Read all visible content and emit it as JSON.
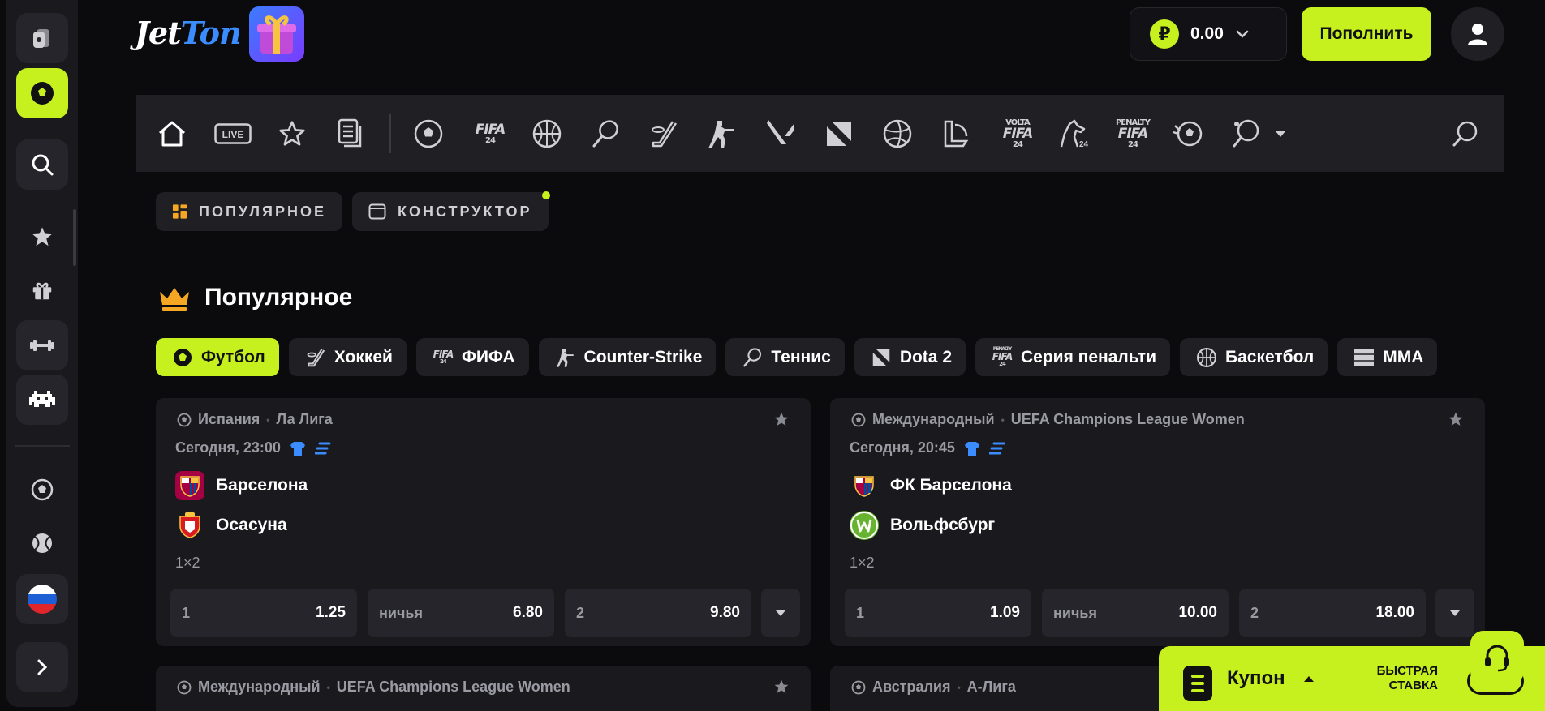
{
  "header": {
    "logo_part1": "Jet",
    "logo_part2": "Ton",
    "balance": "0.00",
    "currency_symbol": "₽",
    "deposit_label": "Пополнить"
  },
  "sports_nav": {
    "items": [
      "home-icon",
      "live-icon",
      "favorites-icon",
      "betslip-history-icon",
      "football-icon",
      "fifa-icon",
      "basketball-icon",
      "tennis-icon",
      "hockey-icon",
      "counter-strike-icon",
      "valorant-icon",
      "dota-icon",
      "volleyball-icon",
      "league-of-legends-icon",
      "volta-fifa-icon",
      "horse-racing-icon",
      "penalty-fifa-icon",
      "futsal-icon",
      "table-tennis-icon"
    ],
    "live_label": "LIVE",
    "fifa_label": "FIFA",
    "fifa_year": "24",
    "volta_label": "VOLTA",
    "penalty_label": "PENALTY"
  },
  "subtabs": {
    "popular": "ПОПУЛЯРНОЕ",
    "builder": "КОНСТРУКТОР"
  },
  "section": {
    "title": "Популярное"
  },
  "chips": [
    {
      "label": "Футбол",
      "icon": "football-icon",
      "active": true
    },
    {
      "label": "Хоккей",
      "icon": "hockey-icon"
    },
    {
      "label": "ФИФА",
      "icon": "fifa-icon"
    },
    {
      "label": "Counter-Strike",
      "icon": "counter-strike-icon"
    },
    {
      "label": "Теннис",
      "icon": "tennis-icon"
    },
    {
      "label": "Dota 2",
      "icon": "dota-icon"
    },
    {
      "label": "Серия пенальти",
      "icon": "penalty-fifa-icon"
    },
    {
      "label": "Баскетбол",
      "icon": "basketball-icon"
    },
    {
      "label": "MMA",
      "icon": "mma-icon"
    }
  ],
  "matches": [
    {
      "country": "Испания",
      "league": "Ла Лига",
      "time": "Сегодня, 23:00",
      "team1": "Барселона",
      "team2": "Осасуна",
      "market": "1×2",
      "odds": [
        {
          "label": "1",
          "value": "1.25"
        },
        {
          "label": "ничья",
          "value": "6.80"
        },
        {
          "label": "2",
          "value": "9.80"
        }
      ]
    },
    {
      "country": "Международный",
      "league": "UEFA Champions League Women",
      "time": "Сегодня, 20:45",
      "team1": "ФК Барселона",
      "team2": "Вольфсбург",
      "market": "1×2",
      "odds": [
        {
          "label": "1",
          "value": "1.09"
        },
        {
          "label": "ничья",
          "value": "10.00"
        },
        {
          "label": "2",
          "value": "18.00"
        }
      ]
    },
    {
      "country": "Международный",
      "league": "UEFA Champions League Women"
    },
    {
      "country": "Австралия",
      "league": "A-Лига"
    }
  ],
  "coupon": {
    "label": "Купон",
    "fast_bet_line1": "БЫСТРАЯ",
    "fast_bet_line2": "СТАВКА"
  },
  "colors": {
    "accent": "#c6f01e",
    "background": "#0b0b0d",
    "panel": "#1f1f24",
    "card": "#1a1a1e",
    "muted_text": "#9a9aa2",
    "link_blue": "#3b8cff"
  }
}
